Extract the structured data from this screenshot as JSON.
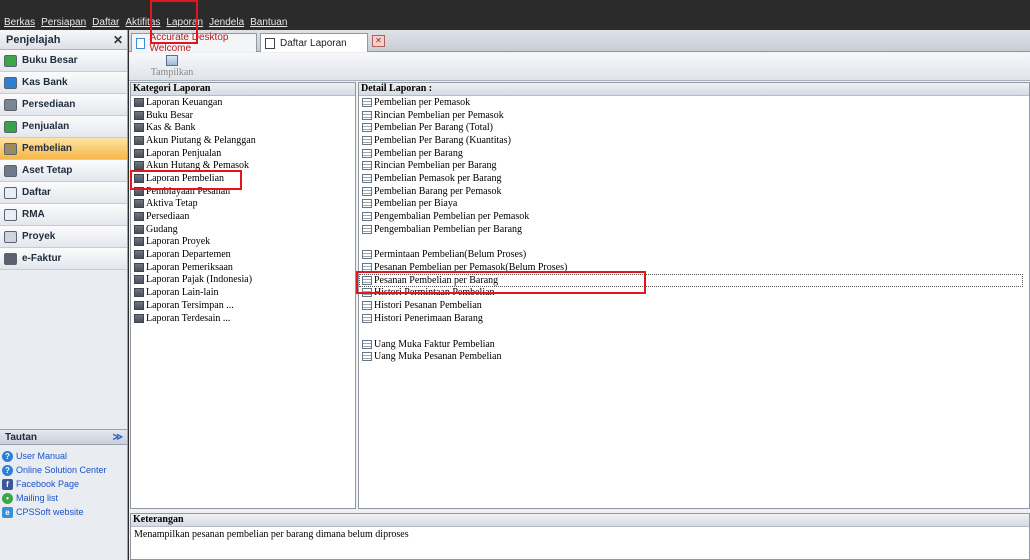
{
  "menu": [
    "Berkas",
    "Persiapan",
    "Daftar",
    "Aktifitas",
    "Laporan",
    "Jendela",
    "Bantuan"
  ],
  "explorer": {
    "title": "Penjelajah",
    "close_glyph": "✕",
    "items": [
      {
        "label": "Buku Besar",
        "icon": "ledger-icon",
        "color": "#3aa64a"
      },
      {
        "label": "Kas Bank",
        "icon": "cash-bank-icon",
        "color": "#2f7fd0"
      },
      {
        "label": "Persediaan",
        "icon": "inventory-icon",
        "color": "#7b8594"
      },
      {
        "label": "Penjualan",
        "icon": "sales-icon",
        "color": "#39a14b"
      },
      {
        "label": "Pembelian",
        "icon": "cart-icon",
        "color": "#9c8a60"
      },
      {
        "label": "Aset Tetap",
        "icon": "home-icon",
        "color": "#6f7a8a"
      },
      {
        "label": "Daftar",
        "icon": "list-icon",
        "color": "#e8eef6"
      },
      {
        "label": "RMA",
        "icon": "rma-icon",
        "color": "#e8eef6"
      },
      {
        "label": "Proyek",
        "icon": "project-icon",
        "color": "#cfd5dd"
      },
      {
        "label": "e-Faktur",
        "icon": "efaktur-icon",
        "color": "#58616d"
      }
    ],
    "active_index": 4
  },
  "tautan": {
    "title": "Tautan",
    "chevron": "≫",
    "links": [
      {
        "label": "User Manual",
        "icon": "help-icon",
        "color": "#2f7fd0",
        "glyph": "?"
      },
      {
        "label": "Online Solution Center",
        "icon": "help-icon",
        "color": "#2f7fd0",
        "glyph": "?"
      },
      {
        "label": "Facebook Page",
        "icon": "facebook-icon",
        "color": "#3b5998",
        "glyph": "f"
      },
      {
        "label": "Mailing list",
        "icon": "people-icon",
        "color": "#3aa64a",
        "glyph": "•"
      },
      {
        "label": "CPSSoft website",
        "icon": "browser-icon",
        "color": "#3a8fd8",
        "glyph": "e"
      }
    ]
  },
  "tabs": [
    {
      "label": "Accurate Desktop Welcome",
      "icon": "browser-icon"
    },
    {
      "label": "Daftar Laporan",
      "icon": "page-icon"
    }
  ],
  "tab_close_glyph": "✕",
  "toolbar": {
    "tampilkan_label": "Tampilkan"
  },
  "kategori": {
    "title": "Kategori Laporan",
    "items": [
      "Laporan Keuangan",
      "Buku Besar",
      "Kas & Bank",
      "Akun Piutang & Pelanggan",
      "Laporan Penjualan",
      "Akun Hutang & Pemasok",
      "Laporan Pembelian",
      "Pembiayaan Pesanan",
      "Aktiva Tetap",
      "Persediaan",
      "Gudang",
      "Laporan Proyek",
      "Laporan Departemen",
      "Laporan Pemeriksaan",
      "Laporan Pajak (Indonesia)",
      "Laporan Lain-lain",
      "Laporan Tersimpan ...",
      "Laporan Terdesain ..."
    ]
  },
  "detail": {
    "title": "Detail Laporan :",
    "groups": [
      [
        "Pembelian per Pemasok",
        "Rincian Pembelian per Pemasok",
        "Pembelian Per Barang (Total)",
        "Pembelian Per Barang (Kuantitas)",
        "Pembelian per Barang",
        "Rincian Pembelian per Barang",
        "Pembelian Pemasok per Barang",
        "Pembelian Barang per Pemasok",
        "Pembelian per Biaya",
        "Pengembalian Pembelian per Pemasok",
        "Pengembalian Pembelian per Barang"
      ],
      [
        "Permintaan Pembelian(Belum Proses)",
        "Pesanan Pembelian per Pemasok(Belum Proses)",
        "Pesanan Pembelian per Barang",
        "Histori Permintaan Pembelian",
        "Histori Pesanan Pembelian",
        "Histori Penerimaan Barang"
      ],
      [
        "Uang Muka Faktur Pembelian",
        "Uang Muka Pesanan Pembelian"
      ]
    ]
  },
  "keterangan": {
    "title": "Keterangan",
    "text": "Menampilkan pesanan pembelian per barang dimana belum diproses"
  }
}
